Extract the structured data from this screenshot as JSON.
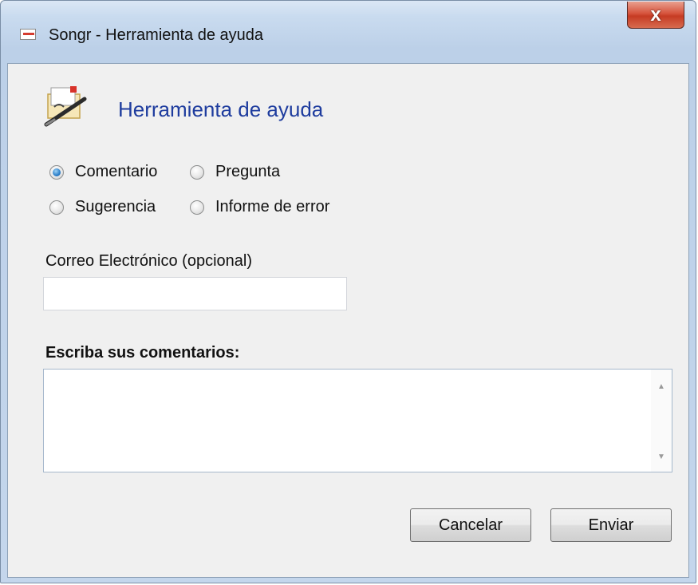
{
  "window": {
    "title": "Songr - Herramienta de ayuda",
    "close_label": "x"
  },
  "header": {
    "title": "Herramienta de ayuda",
    "icon": "feedback-pen-icon"
  },
  "feedback_type": {
    "selected": "Comentario",
    "options": [
      {
        "label": "Comentario",
        "checked": true
      },
      {
        "label": "Pregunta",
        "checked": false
      },
      {
        "label": "Sugerencia",
        "checked": false
      },
      {
        "label": "Informe de error",
        "checked": false
      }
    ]
  },
  "email": {
    "label": "Correo Electrónico (opcional)",
    "value": ""
  },
  "comments": {
    "label": "Escriba sus comentarios:",
    "value": ""
  },
  "buttons": {
    "cancel": "Cancelar",
    "send": "Enviar"
  },
  "colors": {
    "header_title": "#1e3c9e",
    "close_button": "#c63b23",
    "dialog_background": "#f0f0f0"
  }
}
